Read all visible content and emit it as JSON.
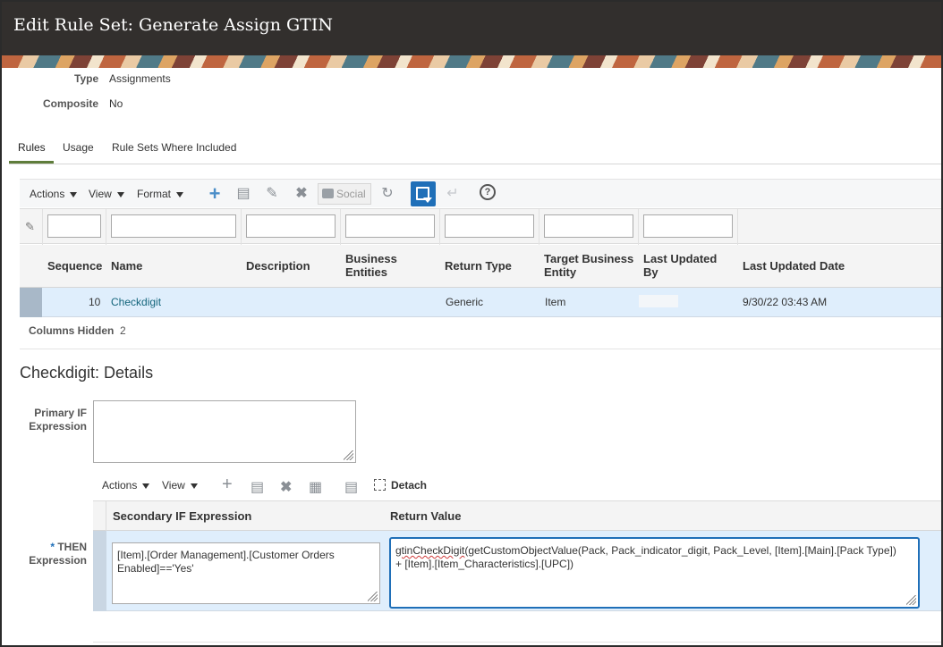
{
  "window": {
    "title": "Edit Rule Set: Generate Assign GTIN"
  },
  "fields": {
    "type_label": "Type",
    "type_value": "Assignments",
    "composite_label": "Composite",
    "composite_value": "No"
  },
  "tabs": [
    {
      "label": "Rules",
      "active": true
    },
    {
      "label": "Usage",
      "active": false
    },
    {
      "label": "Rule Sets Where Included",
      "active": false
    }
  ],
  "toolbar": {
    "actions": "Actions",
    "view": "View",
    "format": "Format",
    "social": "Social",
    "help": "?"
  },
  "table": {
    "headers": {
      "sequence": "Sequence",
      "name": "Name",
      "description": "Description",
      "business_entities_1": "Business",
      "business_entities_2": "Entities",
      "return_type": "Return Type",
      "target_1": "Target Business",
      "target_2": "Entity",
      "last_updated_by_1": "Last Updated",
      "last_updated_by_2": "By",
      "last_updated_date": "Last Updated Date"
    },
    "rows": [
      {
        "sequence": "10",
        "name": "Checkdigit",
        "description": "",
        "business_entities": "",
        "return_type": "Generic",
        "target_business_entity": "Item",
        "last_updated_by": "",
        "last_updated_date": "9/30/22 03:43 AM"
      }
    ],
    "columns_hidden_label": "Columns Hidden",
    "columns_hidden_value": "2"
  },
  "details": {
    "title": "Checkdigit: Details",
    "primary_if_label_1": "Primary IF",
    "primary_if_label_2": "Expression",
    "primary_if_value": "",
    "sub_toolbar": {
      "actions": "Actions",
      "view": "View",
      "detach": "Detach"
    },
    "sub_headers": {
      "secondary_if": "Secondary IF Expression",
      "return_value": "Return Value"
    },
    "then_label_req": "*",
    "then_label_1": "THEN",
    "then_label_2": "Expression",
    "secondary_if_value": "[Item].[Order Management].[Customer Orders Enabled]=='Yes'",
    "return_value_fn": "gtinCheckDigit",
    "return_value_rest": "(getCustomObjectValue(Pack, Pack_indicator_digit, Pack_Level, [Item].[Main].[Pack Type]) + [Item].[Item_Characteristics].[UPC])"
  },
  "colors": {
    "title_bar": "#322f2d",
    "accent_blue": "#1f6fb8",
    "link": "#14657c",
    "selected_row": "#dfeefc",
    "tab_underline": "#5f7d3b"
  }
}
